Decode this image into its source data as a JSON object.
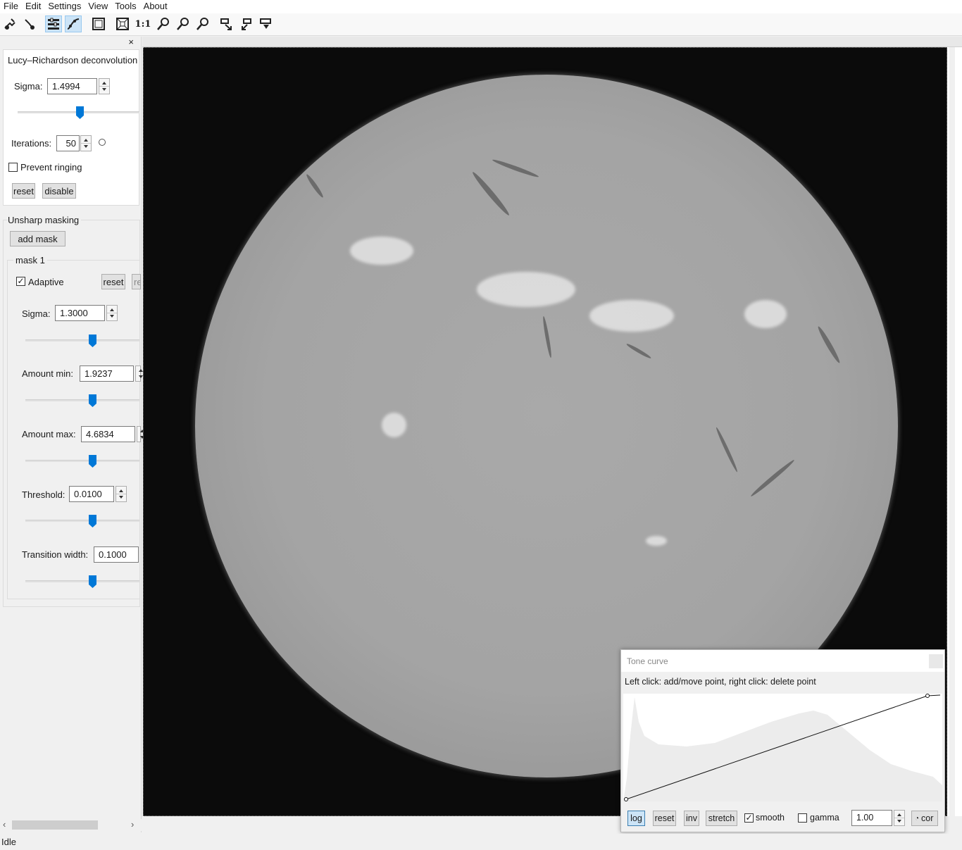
{
  "menu": [
    "File",
    "Edit",
    "Settings",
    "View",
    "Tools",
    "About"
  ],
  "toolbar": {
    "zoom_1_1_label": "1:1",
    "icons": [
      "open-image-icon",
      "save-image-icon",
      "toggle-settings-icon",
      "tone-curve-icon",
      "fit-window-icon",
      "fit-window-alt-icon",
      "zoom-in-icon",
      "zoom-out-icon",
      "zoom-fit-icon",
      "align-images-icon",
      "export-icon",
      "batch-icon"
    ]
  },
  "dock": {
    "close": "×",
    "lr": {
      "title": "Lucy–Richardson deconvolution",
      "sigma_label": "Sigma:",
      "sigma_value": "1.4994",
      "sigma_slider": 0.48,
      "iterations_label": "Iterations:",
      "iterations_value": "50",
      "prevent_ringing": "Prevent ringing",
      "prevent_ringing_checked": false,
      "reset": "reset",
      "disable": "disable"
    },
    "us": {
      "title": "Unsharp masking",
      "add_mask": "add mask",
      "mask_title": "mask 1",
      "adaptive": "Adaptive",
      "adaptive_checked": true,
      "reset": "reset",
      "remove_cut": "re",
      "sigma_label": "Sigma:",
      "sigma_value": "1.3000",
      "amount_min_label": "Amount min:",
      "amount_min_value": "1.9237",
      "amount_max_label": "Amount max:",
      "amount_max_value": "4.6834",
      "threshold_label": "Threshold:",
      "threshold_value": "0.0100",
      "transition_label": "Transition width:",
      "transition_value": "0.1000",
      "slider_level": 0.5
    }
  },
  "tone_curve": {
    "title": "Tone curve",
    "hint": "Left click: add/move point, right click: delete point",
    "log": "log",
    "log_active": true,
    "reset": "reset",
    "inv": "inv",
    "stretch": "stretch",
    "smooth": "smooth",
    "smooth_checked": true,
    "gamma": "gamma",
    "gamma_checked": false,
    "gamma_value": "1.00",
    "cor": "cor"
  },
  "status": "Idle"
}
